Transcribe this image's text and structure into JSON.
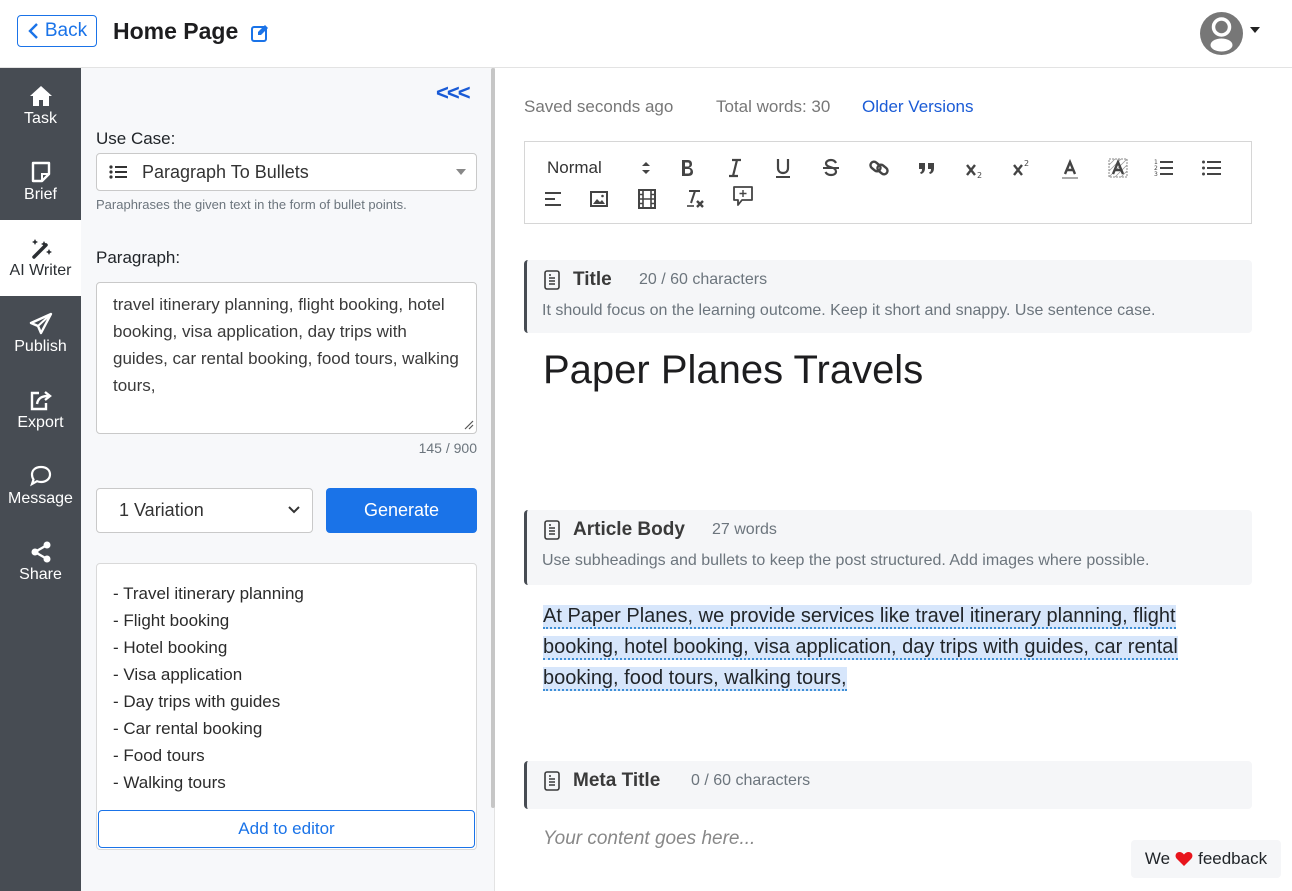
{
  "header": {
    "back_label": "Back",
    "page_title": "Home Page"
  },
  "sidebar": {
    "items": [
      {
        "label": "Task",
        "icon": "home-icon"
      },
      {
        "label": "Brief",
        "icon": "sticky-note-icon"
      },
      {
        "label": "AI Writer",
        "icon": "magic-wand-icon",
        "active": true
      },
      {
        "label": "Publish",
        "icon": "paper-plane-icon"
      },
      {
        "label": "Export",
        "icon": "export-icon"
      },
      {
        "label": "Message",
        "icon": "chat-bubble-icon"
      },
      {
        "label": "Share",
        "icon": "share-icon"
      }
    ]
  },
  "panel": {
    "collapse_label": "<<<",
    "use_case_label": "Use Case:",
    "use_case_value": "Paragraph To Bullets",
    "use_case_hint": "Paraphrases the given text in the form of bullet points.",
    "paragraph_label": "Paragraph:",
    "paragraph_value": "travel itinerary planning, flight booking, hotel booking, visa application, day trips with guides, car rental booking, food tours, walking tours,",
    "char_count": "145 / 900",
    "variation_value": "1 Variation",
    "generate_label": "Generate",
    "output_items": [
      "- Travel itinerary planning",
      "- Flight booking",
      "- Hotel booking",
      "- Visa application",
      "- Day trips with guides",
      "- Car rental booking",
      "- Food tours",
      "- Walking tours"
    ],
    "add_to_editor_label": "Add to editor"
  },
  "editor": {
    "saved_status": "Saved seconds ago",
    "total_words": "Total words: 30",
    "older_versions": "Older Versions",
    "toolbar": {
      "header_select": "Normal",
      "buttons": [
        "bold",
        "italic",
        "underline",
        "strike",
        "link",
        "blockquote",
        "subscript",
        "superscript",
        "text-color",
        "background-color",
        "ordered-list",
        "bullet-list",
        "align",
        "image",
        "video",
        "clear-format",
        "add-comment"
      ]
    },
    "sections": {
      "title": {
        "heading": "Title",
        "meta": "20 / 60 characters",
        "description": "It should focus on the learning outcome. Keep it short and snappy. Use sentence case.",
        "content": "Paper Planes Travels"
      },
      "body": {
        "heading": "Article Body",
        "meta": "27 words",
        "description": "Use subheadings and bullets to keep the post structured. Add images where possible.",
        "lines": [
          "At Paper Planes, we provide services like travel itinerary planning, flight",
          "booking, hotel booking, visa application, day trips with guides, car rental",
          "booking, food tours, walking tours,"
        ]
      },
      "meta_title": {
        "heading": "Meta Title",
        "meta": "0 / 60 characters",
        "placeholder": "Your content goes here..."
      }
    }
  },
  "feedback": {
    "before": "We",
    "after": "feedback"
  },
  "colors": {
    "accent": "#1a73e8",
    "sidebar_bg": "#474c53",
    "selection": "#d7e6fb",
    "heart": "#e8141c"
  }
}
